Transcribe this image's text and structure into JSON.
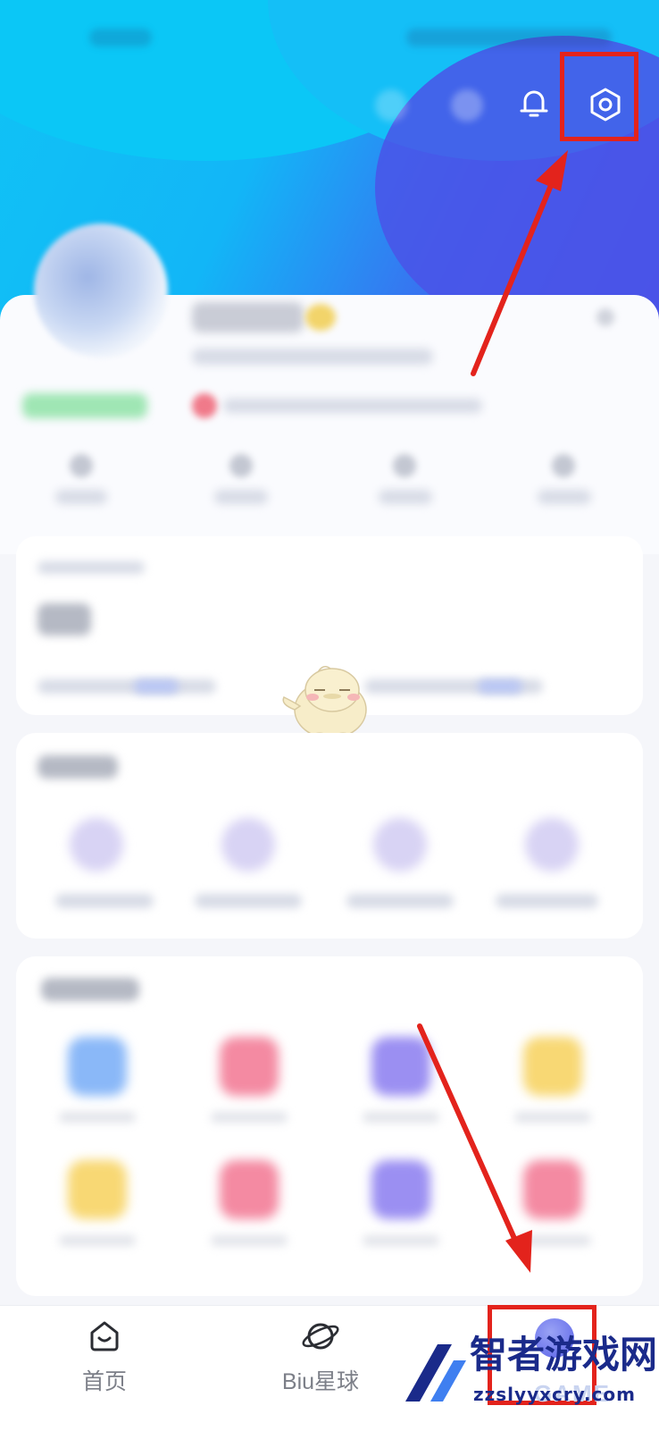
{
  "header": {
    "bell_icon": "bell-icon",
    "settings_icon": "hexagon-settings-icon",
    "highlight_color": "#e3231c"
  },
  "bottom_nav": {
    "items": [
      {
        "label": "首页",
        "icon": "home-icon"
      },
      {
        "label": "Biu星球",
        "icon": "planet-icon"
      },
      {
        "label": "",
        "icon": "profile-avatar-icon"
      }
    ]
  },
  "watermark": {
    "title": "智者游戏网",
    "url": "zzslyyxcry.com",
    "overlay": "GAME"
  },
  "colors": {
    "header_gradient_start": "#10c3f5",
    "header_gradient_end": "#4b51e8",
    "arrow": "#e3231c",
    "nav_text": "#7c7f88"
  }
}
